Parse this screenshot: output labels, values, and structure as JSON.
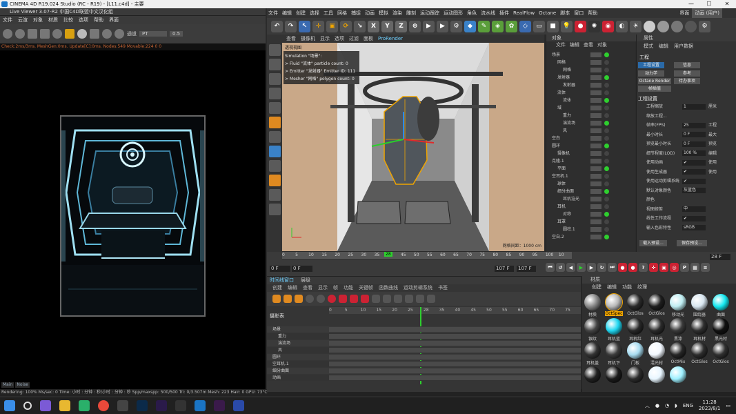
{
  "window": {
    "title": "CINEMA 4D R19.024 Studio (RC - R19) - [L11.c4d] - 主要",
    "controls": [
      "—",
      "☐",
      "✕"
    ]
  },
  "live_viewer": {
    "title": "Live Viewer 3.07-R2 中国C4D联盟中文汉化组",
    "menu": [
      "文件",
      "云渲",
      "对象",
      "材质",
      "比较",
      "选项",
      "帮助",
      "界面"
    ],
    "channel_label": "通道",
    "channel_value": "PT",
    "value2": "0.5",
    "status": "Check:2ms/3ms. MeshGen:0ms. Update[C]:0ms. Nodes:549 Movable:224  0 0",
    "tabs": [
      "Main",
      "Noise"
    ]
  },
  "bottom_status": "Rendering: 100%   Ms/sec: 0   Time: 小时 : 分钟 : 秒/小时 : 分钟 : 秒   Spp/maxspp: 500/500   Tri: 0/3.507m  Mesh: 223  Hair: 0    GPU:   73°C",
  "menubar": {
    "items": [
      "文件",
      "编辑",
      "创建",
      "选择",
      "工具",
      "网格",
      "捕捉",
      "动画",
      "模拟",
      "渲染",
      "雕刻",
      "运动跟踪",
      "运动图形",
      "角色",
      "流水线",
      "插件",
      "RealFlow",
      "Octane",
      "脚本",
      "窗口",
      "帮助"
    ],
    "layout_label": "界面",
    "layout_value": "动画 (用户)"
  },
  "viewport": {
    "menu": [
      "查看",
      "摄像机",
      "显示",
      "选项",
      "过滤",
      "面板",
      "ProRender"
    ],
    "header": "透视视图",
    "sim_lines": [
      "Simulation \"场景\":",
      "> Fluid \"流体\" particle count: 0",
      "> Emitter \"发射器\" Emitter ID: 111",
      "> Mesher \"网格\" polygon count: 0"
    ],
    "grid_info": "网格间距：1000 cm"
  },
  "objects": {
    "title": "对象",
    "menu": [
      "文件",
      "编辑",
      "查看",
      "对象"
    ],
    "rows": [
      {
        "name": "场景",
        "indent": 0
      },
      {
        "name": "网格",
        "indent": 1
      },
      {
        "name": "网格",
        "indent": 2
      },
      {
        "name": "发射器",
        "indent": 1
      },
      {
        "name": "发射器",
        "indent": 2
      },
      {
        "name": "流体",
        "indent": 1
      },
      {
        "name": "流体",
        "indent": 2
      },
      {
        "name": "域",
        "indent": 1
      },
      {
        "name": "重力",
        "indent": 2
      },
      {
        "name": "湍流场",
        "indent": 2
      },
      {
        "name": "风",
        "indent": 2
      },
      {
        "name": "空白",
        "indent": 0
      },
      {
        "name": "圆环",
        "indent": 0
      },
      {
        "name": "摄像机",
        "indent": 1
      },
      {
        "name": "克隆.1",
        "indent": 0
      },
      {
        "name": "平面",
        "indent": 1
      },
      {
        "name": "空耳机.1",
        "indent": 0
      },
      {
        "name": "球体",
        "indent": 1
      },
      {
        "name": "细分曲面",
        "indent": 1
      },
      {
        "name": "耳机渲光",
        "indent": 2
      },
      {
        "name": "耳机",
        "indent": 1
      },
      {
        "name": "对称",
        "indent": 2
      },
      {
        "name": "耳罩",
        "indent": 1
      },
      {
        "name": "圆柱.1",
        "indent": 2
      },
      {
        "name": "空白.2",
        "indent": 0
      }
    ]
  },
  "attributes": {
    "title": "属性",
    "menu": [
      "模式",
      "编辑",
      "用户数据"
    ],
    "section": "工程",
    "tabs": [
      "工程设置",
      "信息",
      "动力学",
      "参考",
      "Octane Render",
      "待办事项",
      "帧插值"
    ],
    "group": "工程设置",
    "rows": [
      {
        "label": "工程缩放",
        "value": "1",
        "unit": "厘米"
      },
      {
        "label": "缩放工程...",
        "value": "",
        "unit": ""
      },
      {
        "label": "帧率(FPS)",
        "value": "25",
        "unit": "工程"
      },
      {
        "label": "最小时长",
        "value": "0 F",
        "unit": "最大"
      },
      {
        "label": "预览最小时长",
        "value": "0 F",
        "unit": "预览"
      },
      {
        "label": "细节程度(LOD)",
        "value": "100 %",
        "unit": "编辑"
      },
      {
        "label": "使用动画",
        "value": "✔",
        "unit": "使用"
      },
      {
        "label": "使用生成器",
        "value": "✔",
        "unit": "使用"
      },
      {
        "label": "使用运动剪辑系统",
        "value": "✔",
        "unit": ""
      },
      {
        "label": "默认对象颜色",
        "value": "灰蓝色",
        "unit": ""
      },
      {
        "label": "颜色",
        "value": "",
        "unit": ""
      },
      {
        "label": "视图修剪",
        "value": "中",
        "unit": ""
      },
      {
        "label": "线性工作流程",
        "value": "✔",
        "unit": ""
      },
      {
        "label": "输入色彩特性",
        "value": "sRGB",
        "unit": ""
      }
    ],
    "buttons": [
      "载入预设...",
      "保存预设..."
    ]
  },
  "timeline": {
    "ticks": [
      "0",
      "5",
      "10",
      "15",
      "20",
      "25",
      "30",
      "35",
      "40",
      "45",
      "50",
      "55",
      "60",
      "65",
      "70",
      "75",
      "80",
      "85",
      "90",
      "95",
      "100",
      "10"
    ],
    "current": "28",
    "start": "0 F",
    "field2": "0 F",
    "end_a": "107 F",
    "end_b": "107 F",
    "frame_display": "28 F"
  },
  "dope_sheet": {
    "tabs": [
      "时间线窗口",
      "层级"
    ],
    "menu": [
      "创建",
      "编辑",
      "查看",
      "显示",
      "帧",
      "功能",
      "关键帧",
      "函数曲线",
      "运动剪辑系统",
      "书签"
    ],
    "header": "摄影表",
    "ticks": [
      "0",
      "5",
      "10",
      "15",
      "20",
      "25",
      "28",
      "35",
      "40",
      "45",
      "50",
      "55",
      "60",
      "65",
      "70",
      "75"
    ],
    "rows": [
      "场景",
      "重力",
      "湍流场",
      "风",
      "圆环",
      "空耳机.1",
      "细分曲面",
      "动画"
    ]
  },
  "materials": {
    "title": "材质",
    "menu": [
      "创建",
      "编辑",
      "功能",
      "纹理"
    ],
    "items": [
      {
        "label": "材质",
        "color": "#888888"
      },
      {
        "label": "OctSpec",
        "color": "#b9b9b9"
      },
      {
        "label": "OctGlos",
        "color": "#2a2a2a"
      },
      {
        "label": "OctGlos",
        "color": "#1e1e1e"
      },
      {
        "label": "移动光",
        "color": "#bfeef2"
      },
      {
        "label": "围绕器",
        "color": "#d8e6f0"
      },
      {
        "label": "曲面",
        "color": "#16e8f0"
      },
      {
        "label": "银纹",
        "color": "#444444"
      },
      {
        "label": "耳机蓝",
        "color": "#20d6f0"
      },
      {
        "label": "耳机红",
        "color": "#282828"
      },
      {
        "label": "耳机光",
        "color": "#2b2b2b"
      },
      {
        "label": "黑漆",
        "color": "#3a3a3a"
      },
      {
        "label": "耳机材",
        "color": "#2f2f2f"
      },
      {
        "label": "黑光材",
        "color": "#111111"
      },
      {
        "label": "耳机盖",
        "color": "#333333"
      },
      {
        "label": "耳机下",
        "color": "#3c3c3c"
      },
      {
        "label": "门板",
        "color": "#a8dcf0"
      },
      {
        "label": "混光材",
        "color": "#f2f8ff"
      },
      {
        "label": "OctMix",
        "color": "#262626"
      },
      {
        "label": "OctGlos",
        "color": "#2d2d2d"
      },
      {
        "label": "OctGlos",
        "color": "#303030"
      },
      {
        "label": "",
        "color": "#222222"
      },
      {
        "label": "",
        "color": "#1b1b1b"
      },
      {
        "label": "",
        "color": "#2c2c2c"
      },
      {
        "label": "",
        "color": "#e8f6ff"
      },
      {
        "label": "",
        "color": "#9ef0ff"
      }
    ]
  },
  "taskbar": {
    "lang": "ENG",
    "time": "11:28",
    "date": "2023/8/1"
  },
  "colors": {
    "accent": "#2a6aa8",
    "selected": "#f0a500"
  }
}
